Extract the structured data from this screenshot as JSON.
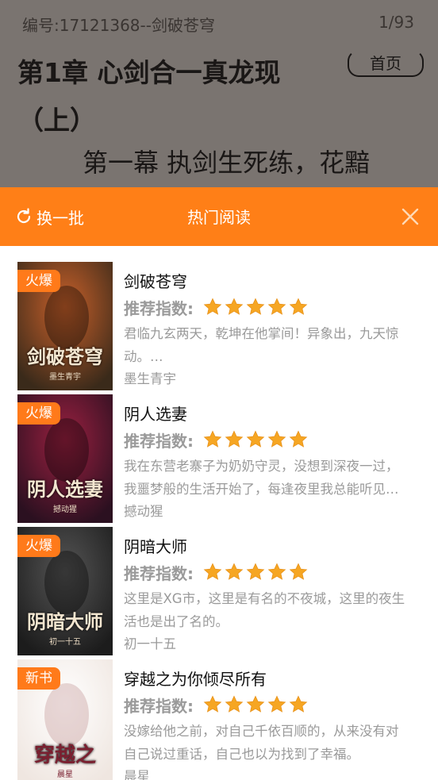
{
  "reader": {
    "book_id_text": "编号:17121368--剑破苍穹",
    "page_indicator": "1/93",
    "chapter_title": "第1章 心剑合一真龙现（上）",
    "home_label": "首页",
    "section_text": "第一幕 执剑生死练，花黯"
  },
  "popup": {
    "refresh_label": "换一批",
    "title": "热门阅读",
    "rating_label": "推荐指数:",
    "items": [
      {
        "badge": "火爆",
        "title": "剑破苍穹",
        "stars": 5,
        "desc": "君临九玄两天，乾坤在他掌间！异象出，九天惊\n动。…",
        "author": "墨生青宇",
        "cover_text": "剑破苍穹",
        "cover_sub": "墨生青宇",
        "cover_color": "#3a2a1a"
      },
      {
        "badge": "火爆",
        "title": "阴人选妻",
        "stars": 5,
        "desc": "我在东营老寨子为奶奶守灵，没想到深夜一过，\n我噩梦般的生活开始了，每逢夜里我总能听见…",
        "author": "撼动猩",
        "cover_text": "阴人选妻",
        "cover_sub": "撼动猩",
        "cover_color": "#2b1020"
      },
      {
        "badge": "火爆",
        "title": "阴暗大师",
        "stars": 5,
        "desc": "这里是XG市，这里是有名的不夜城，这里的夜生\n活也是出了名的。",
        "author": "初一十五",
        "cover_text": "阴暗大师",
        "cover_sub": "初一十五",
        "cover_color": "#1c1c1c"
      },
      {
        "badge": "新书",
        "title": "穿越之为你倾尽所有",
        "stars": 5,
        "desc": "没嫁给他之前，对自己千依百顺的，从来没有对\n自己说过重话，自己也以为找到了幸福。",
        "author": "晨星",
        "cover_text": "穿越之",
        "cover_sub": "晨星",
        "cover_color": "#efe6e0"
      }
    ]
  },
  "colors": {
    "accent": "#ff7f17",
    "badge": "#ff7a1a",
    "star": "#f6a623",
    "muted_text": "#9a9a9a"
  },
  "icons": {
    "refresh": "refresh-icon",
    "close": "close-icon",
    "star": "star-icon"
  }
}
